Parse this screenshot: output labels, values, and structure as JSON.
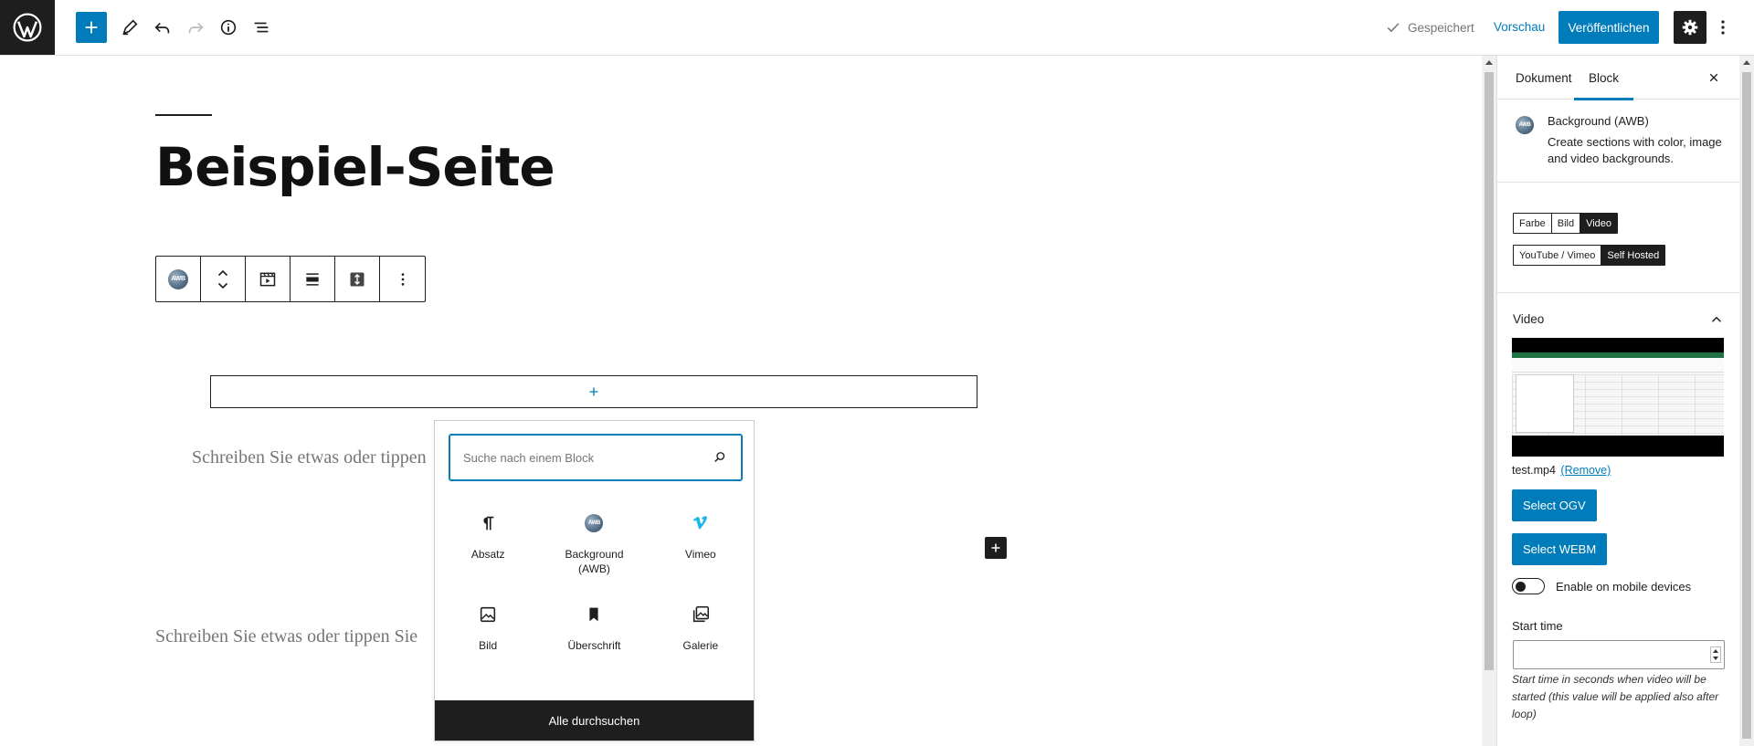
{
  "topbar": {
    "saved_label": "Gespeichert",
    "preview_label": "Vorschau",
    "publish_label": "Veröffentlichen",
    "accent_color": "#007cba"
  },
  "editor": {
    "page_title": "Beispiel-Seite",
    "placeholder_inner": "Schreiben Sie etwas oder tippen",
    "placeholder_outer": "Schreiben Sie etwas oder tippen Sie"
  },
  "block_toolbar": {
    "awb_icon_text": "AWB",
    "items": [
      "awb-block-icon",
      "move-up-down",
      "background-type-icon",
      "align-icon",
      "full-height-icon",
      "more-options-icon"
    ]
  },
  "inserter": {
    "search_placeholder": "Suche nach einem Block",
    "blocks": [
      {
        "label": "Absatz",
        "icon": "paragraph-icon"
      },
      {
        "label": "Background (AWB)",
        "icon": "awb-icon"
      },
      {
        "label": "Vimeo",
        "icon": "vimeo-icon"
      },
      {
        "label": "Bild",
        "icon": "image-icon"
      },
      {
        "label": "Überschrift",
        "icon": "heading-icon"
      },
      {
        "label": "Galerie",
        "icon": "gallery-icon"
      }
    ],
    "browse_all": "Alle durchsuchen"
  },
  "sidebar": {
    "tabs": {
      "document": "Dokument",
      "block": "Block"
    },
    "block_card": {
      "title": "Background (AWB)",
      "description": "Create sections with color, image and video backgrounds."
    },
    "bg_types": [
      "Farbe",
      "Bild",
      "Video"
    ],
    "bg_type_selected": "Video",
    "video_sources": [
      "YouTube / Vimeo",
      "Self Hosted"
    ],
    "video_source_selected": "Self Hosted",
    "video_panel": {
      "title": "Video",
      "file_name": "test.mp4",
      "remove_label": "(Remove)",
      "select_ogv": "Select OGV",
      "select_webm": "Select WEBM",
      "mobile_toggle_label": "Enable on mobile devices",
      "mobile_toggle_on": false,
      "start_time_label": "Start time",
      "start_time_value": "",
      "start_time_help": "Start time in seconds when video will be started (this value will be applied also after loop)"
    }
  }
}
